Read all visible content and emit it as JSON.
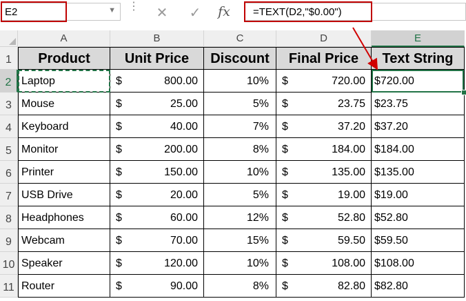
{
  "name_box": {
    "value": "E2"
  },
  "formula_bar": {
    "formula": "=TEXT(D2,\"$0.00\")",
    "fx_label": "fx"
  },
  "columns": [
    "A",
    "B",
    "C",
    "D",
    "E"
  ],
  "rows": [
    "1",
    "2",
    "3",
    "4",
    "5",
    "6",
    "7",
    "8",
    "9",
    "10",
    "11"
  ],
  "headers": [
    "Product",
    "Unit Price",
    "Discount",
    "Final Price",
    "Text String"
  ],
  "currency_symbol": "$",
  "data": [
    {
      "product": "Laptop",
      "unit_price": "800.00",
      "discount": "10%",
      "final_price": "720.00",
      "text": "$720.00"
    },
    {
      "product": "Mouse",
      "unit_price": "25.00",
      "discount": "5%",
      "final_price": "23.75",
      "text": "$23.75"
    },
    {
      "product": "Keyboard",
      "unit_price": "40.00",
      "discount": "7%",
      "final_price": "37.20",
      "text": "$37.20"
    },
    {
      "product": "Monitor",
      "unit_price": "200.00",
      "discount": "8%",
      "final_price": "184.00",
      "text": "$184.00"
    },
    {
      "product": "Printer",
      "unit_price": "150.00",
      "discount": "10%",
      "final_price": "135.00",
      "text": "$135.00"
    },
    {
      "product": "USB Drive",
      "unit_price": "20.00",
      "discount": "5%",
      "final_price": "19.00",
      "text": "$19.00"
    },
    {
      "product": "Headphones",
      "unit_price": "60.00",
      "discount": "12%",
      "final_price": "52.80",
      "text": "$52.80"
    },
    {
      "product": "Webcam",
      "unit_price": "70.00",
      "discount": "15%",
      "final_price": "59.50",
      "text": "$59.50"
    },
    {
      "product": "Speaker",
      "unit_price": "120.00",
      "discount": "10%",
      "final_price": "108.00",
      "text": "$108.00"
    },
    {
      "product": "Router",
      "unit_price": "90.00",
      "discount": "8%",
      "final_price": "82.80",
      "text": "$82.80"
    }
  ],
  "colors": {
    "selection": "#217346",
    "highlight": "#c00000",
    "header_fill": "#d9d9d9"
  }
}
